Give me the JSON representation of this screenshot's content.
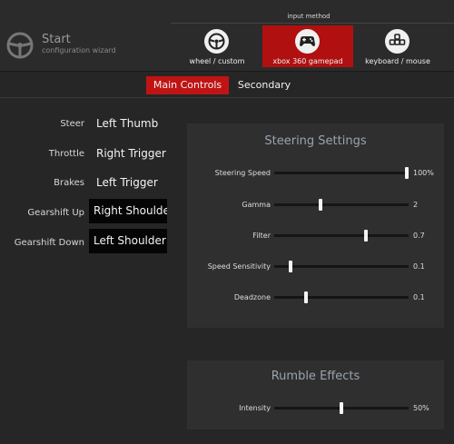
{
  "header": {
    "title": "Start",
    "subtitle": "configuration wizard",
    "logo_icon": "steering-wheel-logo"
  },
  "input_method": {
    "label": "input method",
    "options": [
      {
        "label": "wheel / custom",
        "icon": "steering-wheel-icon",
        "active": false
      },
      {
        "label": "xbox 360 gamepad",
        "icon": "gamepad-icon",
        "active": true
      },
      {
        "label": "keyboard / mouse",
        "icon": "keyboard-icon",
        "active": false
      }
    ]
  },
  "tabs": [
    {
      "label": "Main Controls",
      "active": true
    },
    {
      "label": "Secondary",
      "active": false
    }
  ],
  "mappings": [
    {
      "label": "Steer",
      "value": "Left Thumb"
    },
    {
      "label": "Throttle",
      "value": "Right Trigger"
    },
    {
      "label": "Brakes",
      "value": "Left Trigger"
    },
    {
      "label": "Gearshift Up",
      "value": "Right Shoulder"
    },
    {
      "label": "Gearshift Down",
      "value": "Left Shoulder"
    }
  ],
  "steering": {
    "title": "Steering Settings",
    "sliders": [
      {
        "label": "Steering Speed",
        "value": "100%",
        "level": 1.0
      },
      {
        "label": "Gamma",
        "value": "2",
        "level": 0.34
      },
      {
        "label": "Filter",
        "value": "0.7",
        "level": 0.69
      },
      {
        "label": "Speed Sensitivity",
        "value": "0.1",
        "level": 0.11
      },
      {
        "label": "Deadzone",
        "value": "0.1",
        "level": 0.23
      }
    ]
  },
  "rumble": {
    "title": "Rumble Effects",
    "sliders": [
      {
        "label": "Intensity",
        "value": "50%",
        "level": 0.5
      }
    ]
  },
  "colors": {
    "accent": "#c01414",
    "background": "#262626",
    "panel": "#2f2f2f"
  }
}
